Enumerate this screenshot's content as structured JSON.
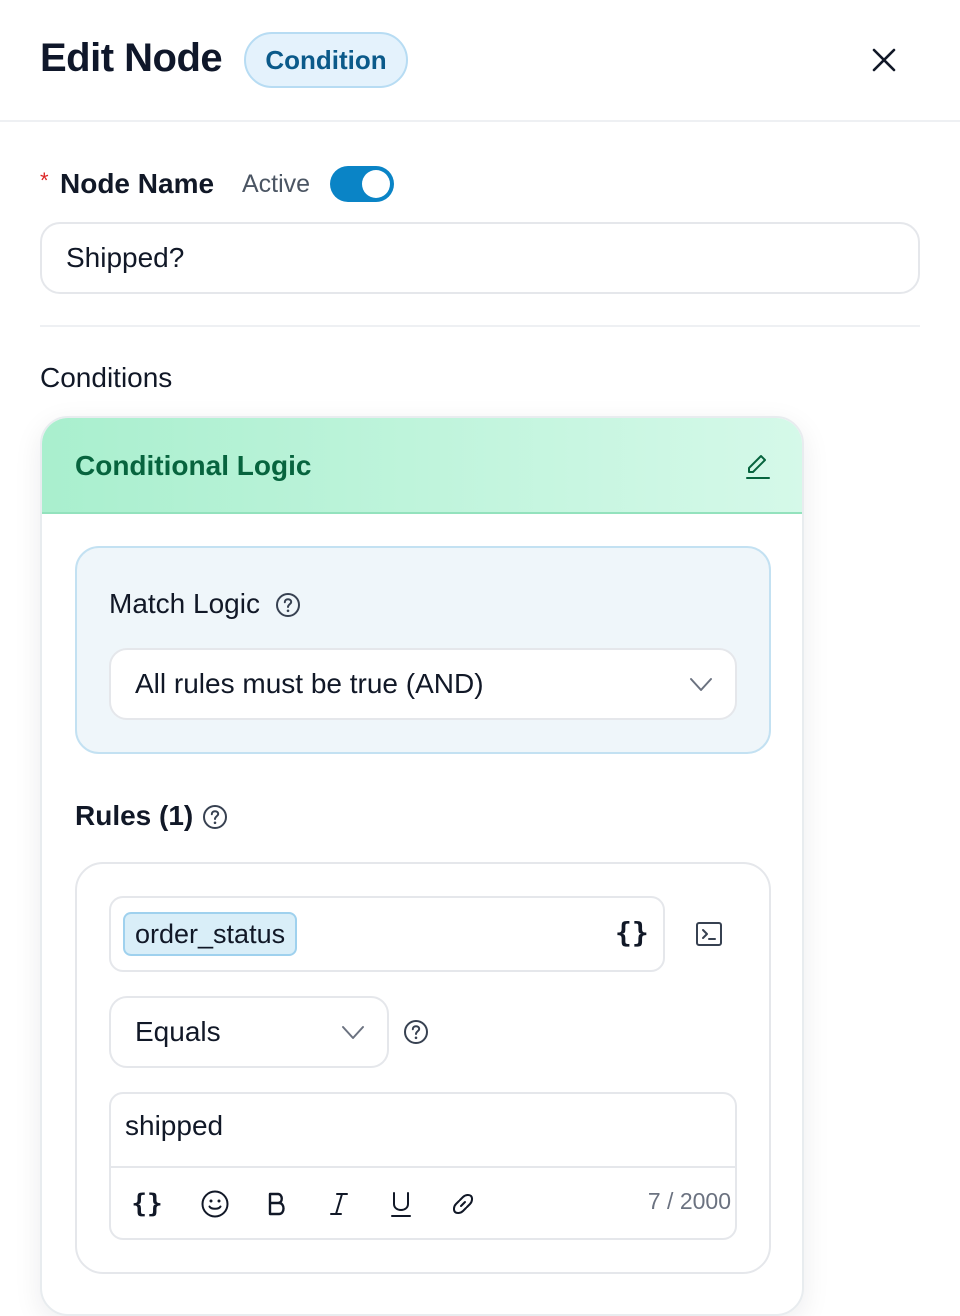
{
  "header": {
    "title": "Edit Node",
    "badge": "Condition"
  },
  "node": {
    "required_mark": "*",
    "name_label": "Node Name",
    "active_label": "Active",
    "active": true,
    "name_value": "Shipped?"
  },
  "conditions": {
    "label": "Conditions",
    "card_title": "Conditional Logic",
    "match": {
      "label": "Match Logic",
      "value": "All rules must be true (AND)"
    },
    "rules_label": "Rules (1)",
    "rule": {
      "variable": "order_status",
      "var_icon": "{}",
      "operator": "Equals",
      "value": "shipped",
      "char_count": "7 / 2000"
    }
  },
  "colors": {
    "accent": "#0a84c6",
    "badge_text": "#0b5a8a",
    "logic_title": "#07643e",
    "required": "#dc2626"
  },
  "icons": [
    "close-icon",
    "edit-icon",
    "help-icon",
    "chevron-down-icon",
    "braces-icon",
    "terminal-icon",
    "emoji-icon",
    "bold-icon",
    "italic-icon",
    "underline-icon",
    "link-icon"
  ]
}
